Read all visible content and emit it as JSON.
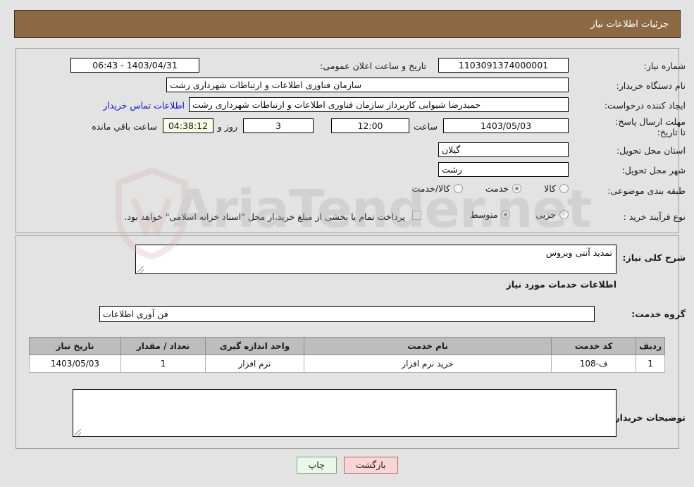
{
  "header": {
    "title": "جزئیات اطلاعات نیاز"
  },
  "top_form": {
    "need_number_label": "شماره نیاز:",
    "need_number_value": "1103091374000001",
    "announce_datetime_label": "تاریخ و ساعت اعلان عمومی:",
    "announce_datetime_value": "1403/04/31 - 06:43",
    "buyer_org_label": "نام دستگاه خریدار:",
    "buyer_org_value": "سازمان فناوری اطلاعات و ارتباطات شهرداری رشت",
    "requester_label": "ایجاد کننده درخواست:",
    "requester_value": "حمیدرضا شیوایی کاربرداز سازمان فناوری اطلاعات و ارتباطات شهرداری رشت",
    "contact_link": "اطلاعات تماس خریدار",
    "deadline_label": "مهلت ارسال پاسخ: تا تاریخ:",
    "deadline_date": "1403/05/03",
    "deadline_hour_label": "ساعت",
    "deadline_hour_value": "12:00",
    "remaining_days_value": "3",
    "remaining_days_label": "روز و",
    "remaining_time_value": "04:38:12",
    "remaining_time_label": "ساعت باقي مانده",
    "province_label": "استان محل تحویل:",
    "province_value": "گیلان",
    "city_label": "شهر محل تحویل:",
    "city_value": "رشت",
    "category_label": "طبقه بندی موضوعی:",
    "category_options": [
      {
        "label": "کالا",
        "selected": false
      },
      {
        "label": "خدمت",
        "selected": true
      },
      {
        "label": "کالا/خدمت",
        "selected": false
      }
    ],
    "process_label": "نوع فرآیند خرید :",
    "process_options": [
      {
        "label": "جزیی",
        "selected": false
      },
      {
        "label": "متوسط",
        "selected": true
      }
    ],
    "treasury_checkbox_checked": false,
    "treasury_text": "پرداخت تمام یا بخشی از مبلغ خرید،از محل \"اسناد خزانه اسلامی\" خواهد بود."
  },
  "middle": {
    "general_desc_label": "شرح کلی نیاز:",
    "general_desc_value": "تمدید آنتی ویروس",
    "services_section_title": "اطلاعات خدمات مورد نیاز",
    "service_group_label": "گروه خدمت:",
    "service_group_value": "فن آوری اطلاعات",
    "buyer_notes_label": "توضیحات خریدار:",
    "buyer_notes_value": ""
  },
  "table": {
    "columns": [
      "ردیف",
      "کد خدمت",
      "نام خدمت",
      "واحد اندازه گیری",
      "تعداد / مقدار",
      "تاریخ نیاز"
    ],
    "rows": [
      {
        "index": "1",
        "code": "ف-108",
        "name": "خرید نرم افزار",
        "unit": "نرم افزار",
        "quantity": "1",
        "date": "1403/05/03"
      }
    ]
  },
  "buttons": {
    "print": "چاپ",
    "back": "بازگشت"
  },
  "watermark": {
    "text": "AriaTender.net"
  },
  "colors": {
    "header_bg": "#8b6a43",
    "page_bg": "#e3e3e3",
    "link": "#1111cc",
    "table_header_bg": "#bdbdbd",
    "print_btn_bg": "#e9f8e9",
    "back_btn_bg": "#fad5d5",
    "countdown_bg": "#fbfbe8"
  }
}
